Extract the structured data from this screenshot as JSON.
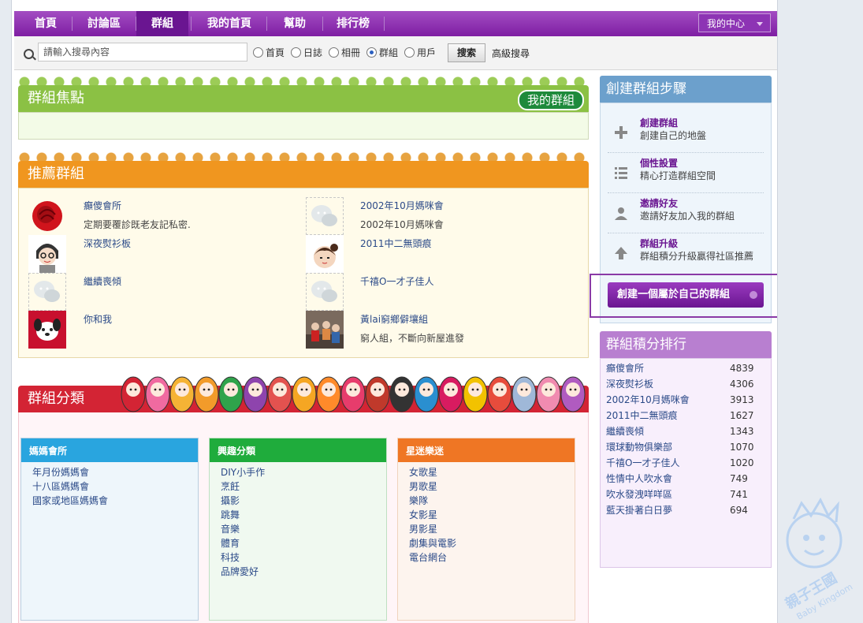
{
  "nav": {
    "items": [
      {
        "label": "首頁"
      },
      {
        "label": "討論區"
      },
      {
        "label": "群組"
      },
      {
        "label": "我的首頁"
      },
      {
        "label": "幫助"
      },
      {
        "label": "排行榜"
      }
    ],
    "active_index": 2,
    "my_center": "我的中心"
  },
  "search": {
    "placeholder": "請輸入搜尋內容",
    "options": [
      "首頁",
      "日誌",
      "相冊",
      "群組",
      "用戶"
    ],
    "selected": "群組",
    "button": "搜索",
    "advanced": "高級搜尋"
  },
  "focus": {
    "title": "群組焦點",
    "my_groups_button": "我的群組"
  },
  "recommended": {
    "title": "推薦群組",
    "left": [
      {
        "name": "癲傻會所",
        "desc": "定期要覆診既老友記私密.",
        "avatar": "rose-icon"
      },
      {
        "name": "深夜熨衫板",
        "desc": "",
        "avatar": "cartoon-girl-icon"
      },
      {
        "name": "繼續喪傾",
        "desc": "",
        "avatar": "chat-bubble-icon"
      },
      {
        "name": "你和我",
        "desc": "",
        "avatar": "cartoon-dog-icon"
      }
    ],
    "right": [
      {
        "name": "2002年10月媽咪會",
        "desc": "2002年10月媽咪會",
        "avatar": "chat-bubble-icon"
      },
      {
        "name": "2011中二無頭痕",
        "desc": "",
        "avatar": "cartoon-boy-icon"
      },
      {
        "name": "千禧O一才子佳人",
        "desc": "",
        "avatar": "chat-bubble-icon"
      },
      {
        "name": "黃lai窮鄉僻壤組",
        "desc": "窮人組，不斷向新屋進發",
        "avatar": "group-photo-icon"
      }
    ]
  },
  "categories": {
    "title": "群組分類",
    "boxes": [
      {
        "title": "媽媽會所",
        "color": "#29a5df",
        "items": [
          "年月份媽媽會",
          "十八區媽媽會",
          "國家或地區媽媽會"
        ]
      },
      {
        "title": "興趣分類",
        "color": "#1fac3c",
        "items": [
          "DIY小手作",
          "烹飪",
          "攝影",
          "跳舞",
          "音樂",
          "體育",
          "科技",
          "品牌愛好"
        ]
      },
      {
        "title": "星迷樂迷",
        "color": "#ef7624",
        "items": [
          "女歌星",
          "男歌星",
          "樂隊",
          "女影星",
          "男影星",
          "劇集與電影",
          "電台網台"
        ]
      }
    ]
  },
  "create_steps": {
    "title": "創建群組步驟",
    "steps": [
      {
        "title": "創建群組",
        "desc": "創建自己的地盤",
        "icon": "plus-icon"
      },
      {
        "title": "個性設置",
        "desc": "精心打造群組空間",
        "icon": "list-icon"
      },
      {
        "title": "邀請好友",
        "desc": "邀請好友加入我的群組",
        "icon": "user-icon"
      },
      {
        "title": "群組升級",
        "desc": "群組積分升級贏得社區推薦",
        "icon": "arrow-up-icon"
      }
    ],
    "create_button": "創建一個屬於自己的群組"
  },
  "ranking": {
    "title": "群組積分排行",
    "rows": [
      {
        "name": "癲傻會所",
        "score": "4839"
      },
      {
        "name": "深夜熨衫板",
        "score": "4306"
      },
      {
        "name": "2002年10月媽咪會",
        "score": "3913"
      },
      {
        "name": "2011中二無頭痕",
        "score": "1627"
      },
      {
        "name": "繼續喪傾",
        "score": "1343"
      },
      {
        "name": "環球動物俱樂部",
        "score": "1070"
      },
      {
        "name": "千禧O一才子佳人",
        "score": "1020"
      },
      {
        "name": "性情中人吹水會",
        "score": "749"
      },
      {
        "name": "吹水發洩咩咩區",
        "score": "741"
      },
      {
        "name": "藍天掛著白日夢",
        "score": "694"
      }
    ]
  },
  "watermark": {
    "text": "親子王國",
    "subtext": "Baby Kingdom"
  }
}
